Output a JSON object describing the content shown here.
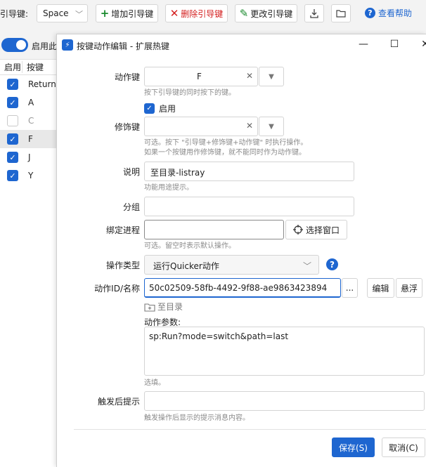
{
  "toolbar": {
    "trigger_label": "引导键:",
    "trigger_value": "Space",
    "add_label": "增加引导键",
    "delete_label": "删除引导键",
    "edit_label": "更改引导键",
    "help_label": "查看帮助",
    "add_color": "#1a8a2e",
    "delete_color": "#d42020",
    "edit_color": "#1a8a2e"
  },
  "main": {
    "enable_label": "启用此",
    "list_headers": [
      "启用",
      "按键"
    ],
    "rows": [
      {
        "enabled": true,
        "key": "Return"
      },
      {
        "enabled": true,
        "key": "A"
      },
      {
        "enabled": false,
        "key": "C"
      },
      {
        "enabled": true,
        "key": "F"
      },
      {
        "enabled": true,
        "key": "J"
      },
      {
        "enabled": true,
        "key": "Y"
      }
    ]
  },
  "dialog": {
    "title": "按键动作编辑 - 扩展热键",
    "action_key_label": "动作键",
    "action_key_value": "F",
    "action_key_hint": "按下引导键的同时按下的键。",
    "enabled_label": "启用",
    "modifier_label": "修饰键",
    "modifier_hint_1": "可选。按下 \"引导键+修饰键+动作键\" 时执行操作。",
    "modifier_hint_2": "如果一个按键用作修饰键，就不能同时作为动作键。",
    "desc_label": "说明",
    "desc_value": "至目录-listray",
    "desc_hint": "功能用途提示。",
    "group_label": "分组",
    "process_label": "绑定进程",
    "select_window_label": "选择窗口",
    "process_hint": "可选。留空时表示默认操作。",
    "optype_label": "操作类型",
    "optype_value": "运行Quicker动作",
    "action_id_label": "动作ID/名称",
    "action_id_value": "50c02509-58fb-4492-9f88-ae9863423894",
    "ellipsis_label": "...",
    "edit_label": "编辑",
    "float_label": "悬浮",
    "to_dir_label": "至目录",
    "params_label": "动作参数:",
    "params_value": "sp:Run?mode=switch&path=last",
    "params_hint": "选填。",
    "after_label": "触发后提示",
    "after_hint": "触发操作后显示的提示消息内容。",
    "save_label": "保存(S)",
    "cancel_label": "取消(C)",
    "accent": "#1e66d0"
  }
}
